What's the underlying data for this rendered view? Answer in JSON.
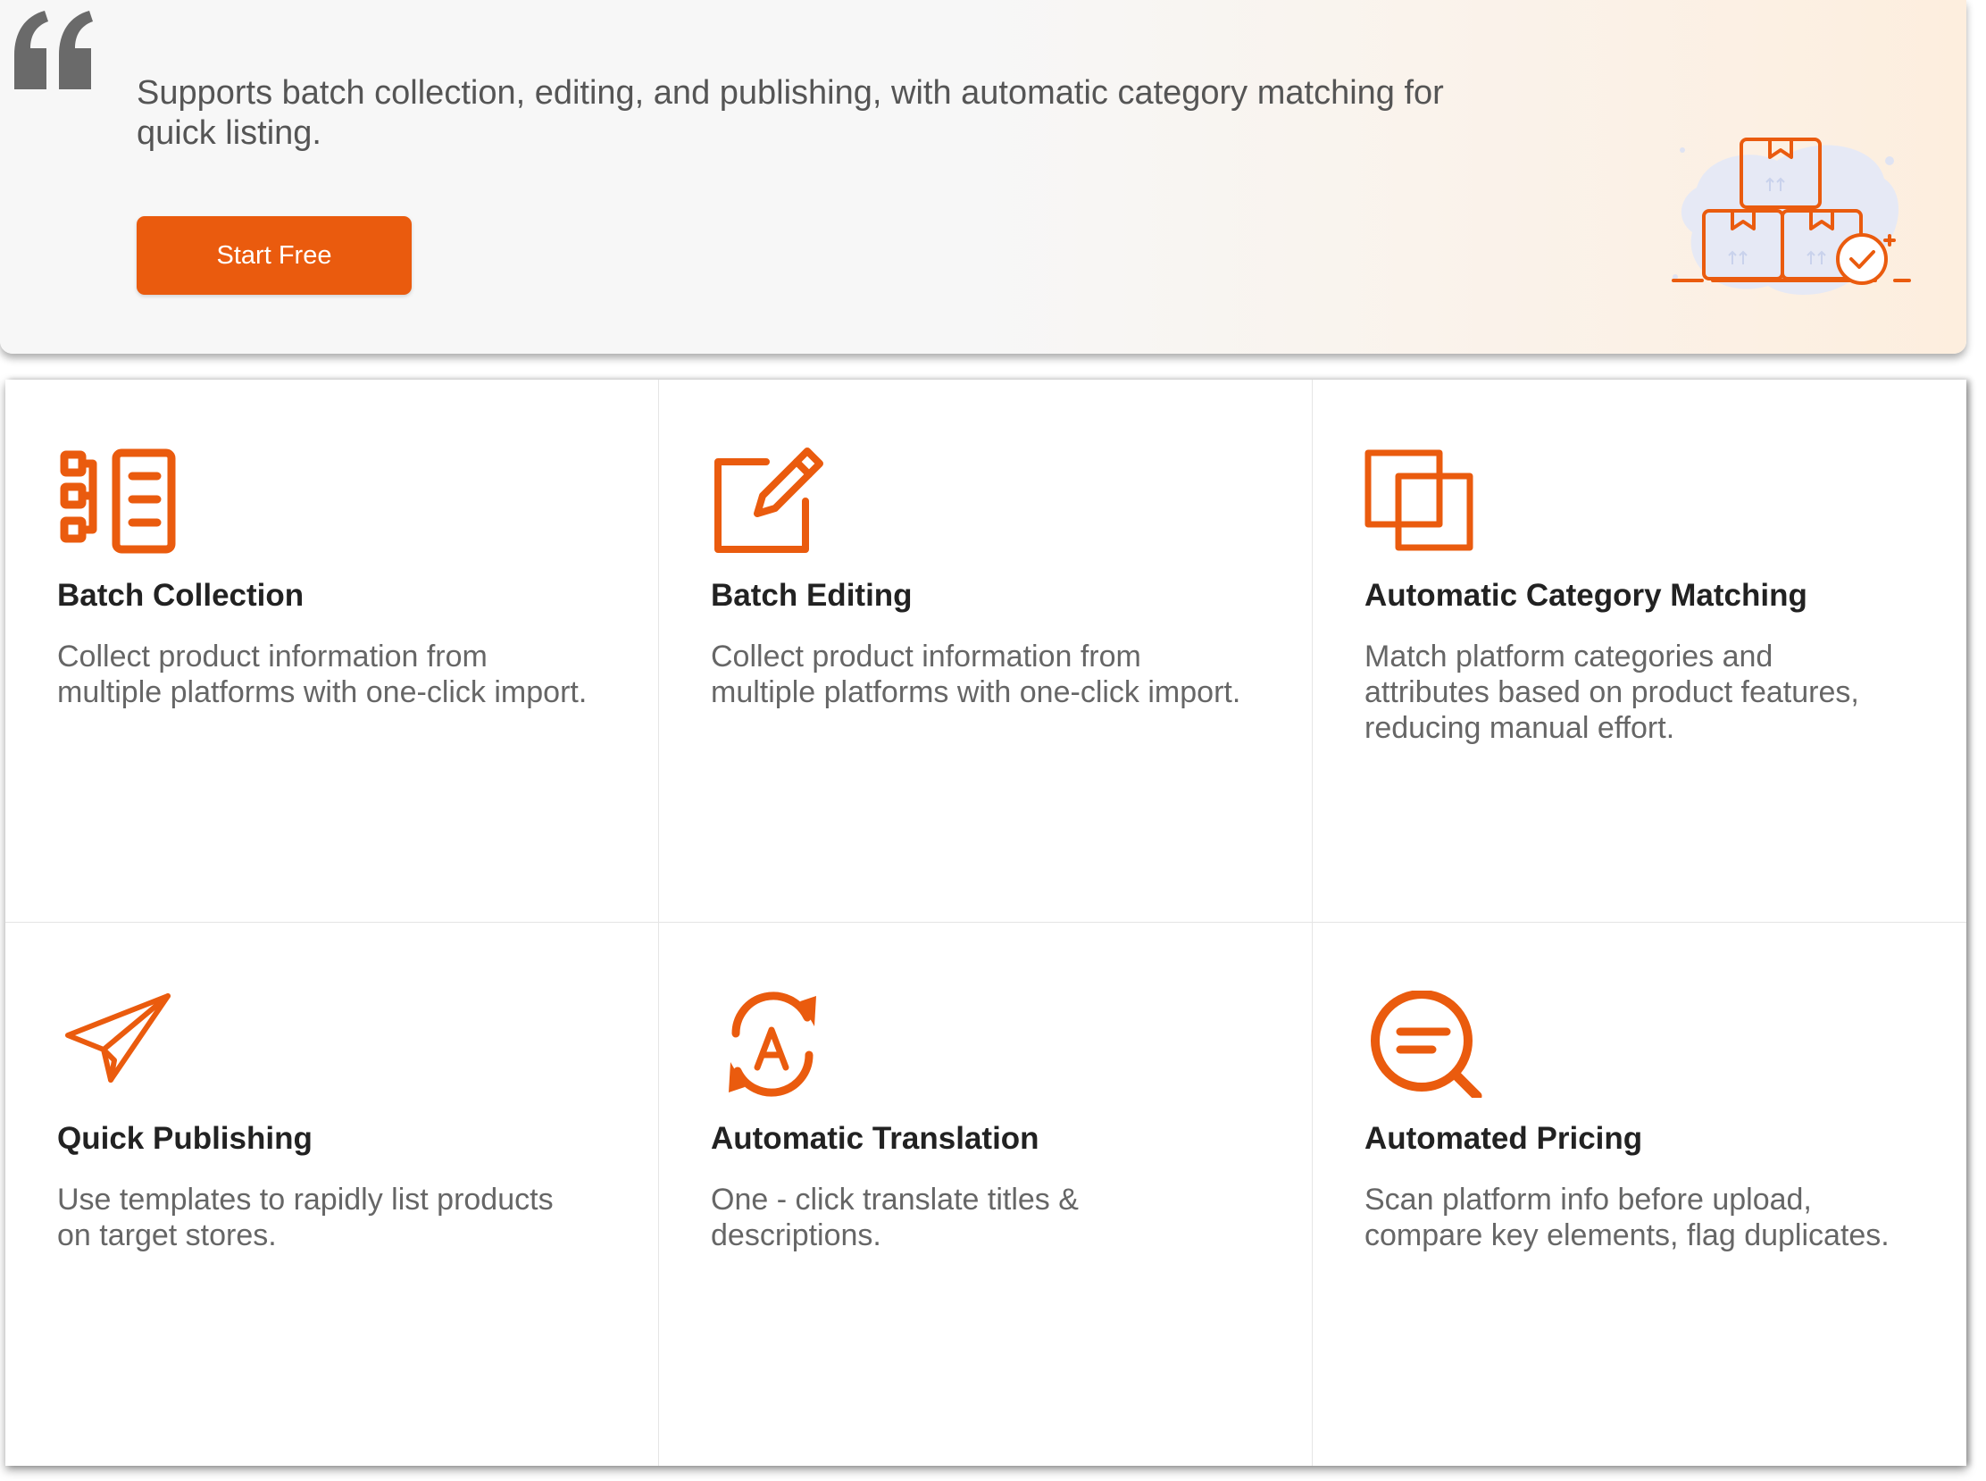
{
  "colors": {
    "accent": "#ea5b0e",
    "text_dark": "#222222",
    "text_muted": "#666666"
  },
  "hero": {
    "description": "Supports batch collection, editing, and publishing, with automatic category matching for quick listing.",
    "cta_label": "Start Free",
    "quote_icon": "quote-icon",
    "illustration": "stacked-boxes-checkmark-illustration"
  },
  "features": [
    {
      "icon": "checklist-icon",
      "title": "Batch Collection",
      "description": "Collect product information from multiple platforms with one-click import."
    },
    {
      "icon": "edit-icon",
      "title": "Batch Editing",
      "description": "Collect product information from multiple platforms with one-click import."
    },
    {
      "icon": "overlapping-squares-icon",
      "title": "Automatic Category Matching",
      "description": "Match platform categories and attributes based on product features, reducing manual effort."
    },
    {
      "icon": "paper-plane-icon",
      "title": "Quick Publishing",
      "description": "Use templates to rapidly list products on target stores."
    },
    {
      "icon": "translate-icon",
      "title": "Automatic Translation",
      "description": "One - click translate titles & descriptions."
    },
    {
      "icon": "search-lines-icon",
      "title": "Automated Pricing",
      "description": "Scan platform info before upload, compare key elements, flag duplicates."
    }
  ]
}
